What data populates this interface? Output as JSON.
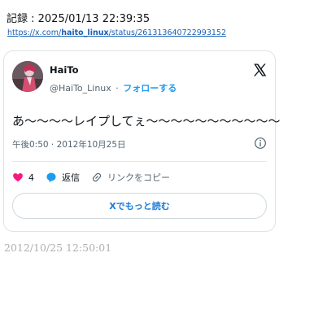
{
  "record": {
    "label": "記録 : 2025/01/13 22:39:35"
  },
  "source": {
    "prefix": "https://x.com/",
    "user": "haito_linux",
    "suffix": "/status/261313640722993152"
  },
  "tweet": {
    "display_name": "HaiTo",
    "handle": "@HaiTo_Linux",
    "separator": "·",
    "follow_label": "フォローする",
    "text": "あ〜〜〜〜レイプしてぇ〜〜〜〜〜〜〜〜〜〜〜",
    "timestamp": "午後0:50 · 2012年10月25日",
    "like_count": "4",
    "reply_label": "返信",
    "copy_link_label": "リンクをコピー",
    "read_more_label": "Xでもっと読む"
  },
  "archive_timestamp": "2012/10/25 12:50:01",
  "colors": {
    "accent": "#1d9bf0",
    "like": "#f91880"
  },
  "icons": {
    "brand": "x-logo-icon",
    "info": "info-icon",
    "like": "heart-icon",
    "reply": "speech-bubble-icon",
    "copy_link": "link-icon"
  }
}
